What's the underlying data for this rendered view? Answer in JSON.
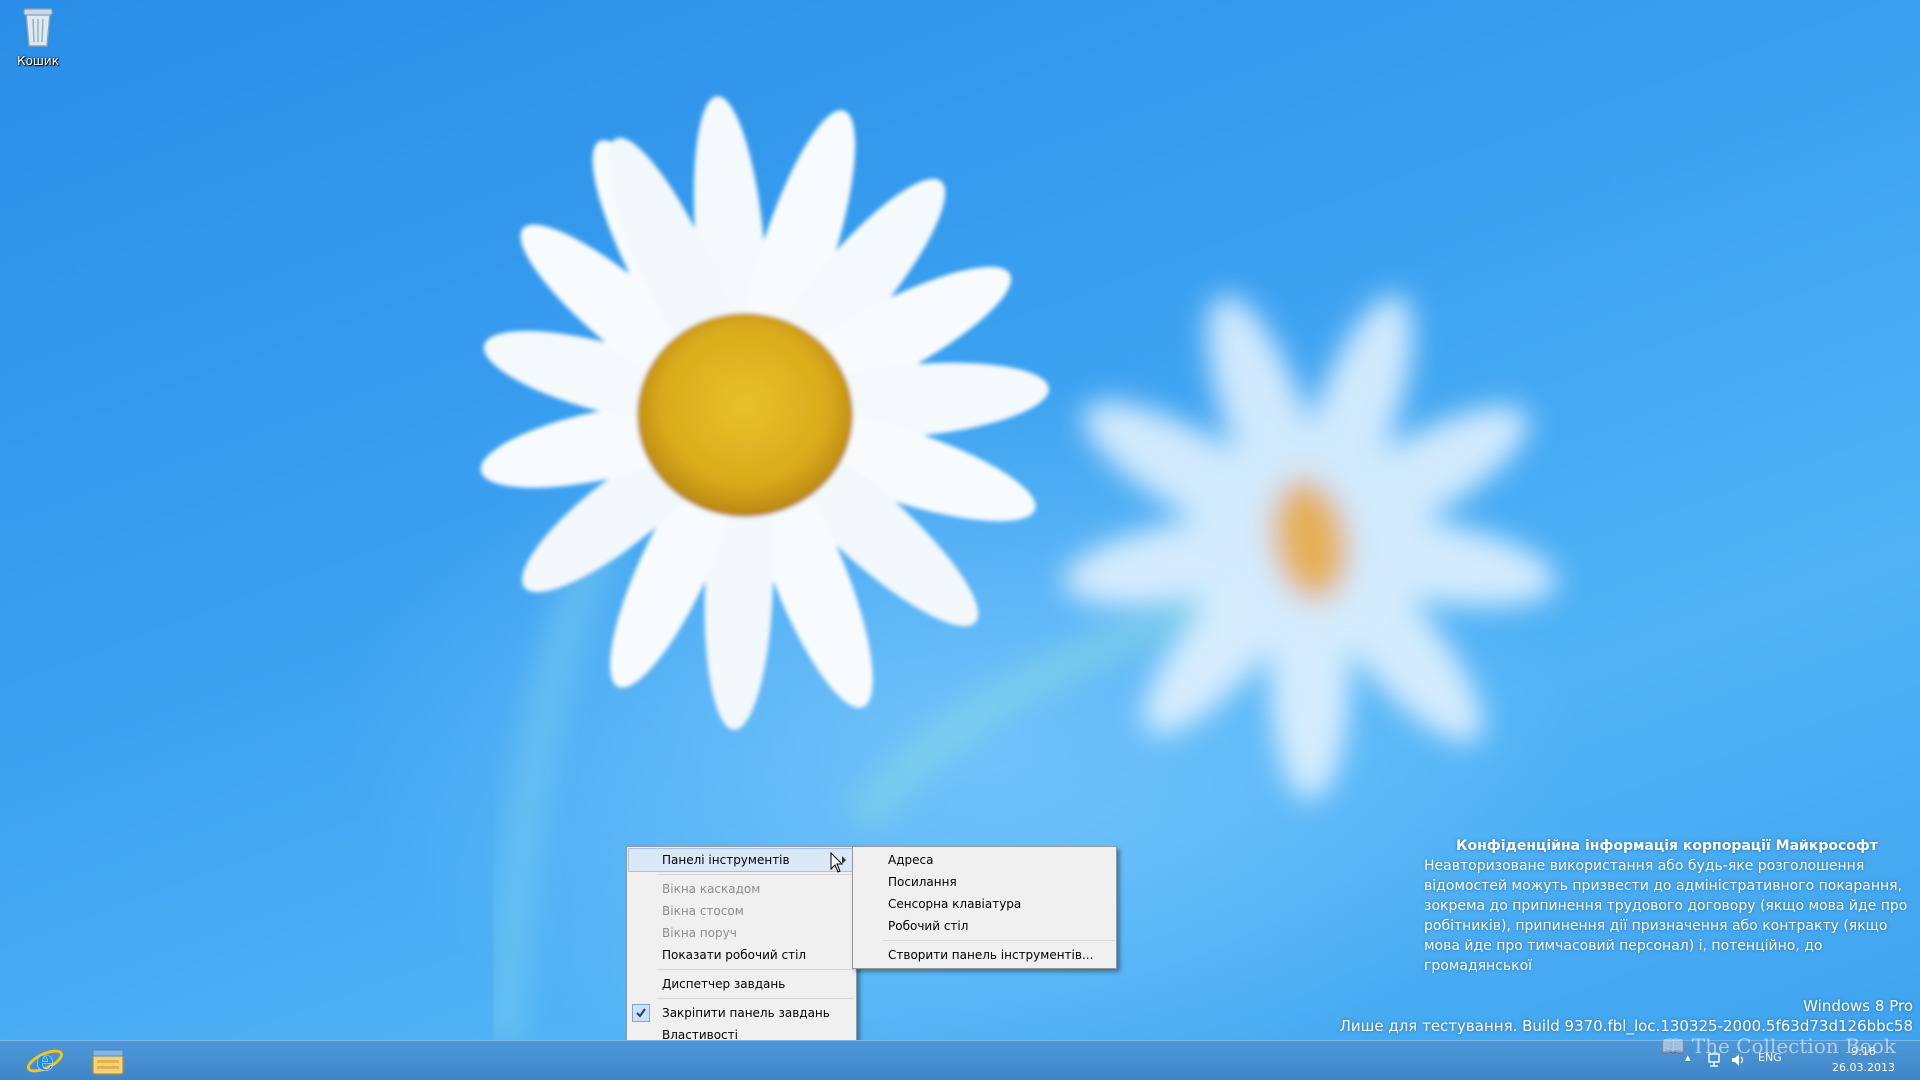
{
  "desktop": {
    "icons": [
      {
        "label": "Кошик",
        "icon": "recycle-bin-icon"
      }
    ]
  },
  "context_menu": {
    "items": [
      {
        "label": "Панелі інструментів",
        "state": "highlighted",
        "has_submenu": true
      },
      {
        "label": "Вікна каскадом",
        "state": "disabled"
      },
      {
        "label": "Вікна стосом",
        "state": "disabled"
      },
      {
        "label": "Вікна поруч",
        "state": "disabled"
      },
      {
        "label": "Показати робочий стіл",
        "state": "enabled"
      },
      {
        "label": "Диспетчер завдань",
        "state": "enabled"
      },
      {
        "label": "Закріпити панель завдань",
        "state": "checked"
      },
      {
        "label": "Властивості",
        "state": "enabled"
      }
    ]
  },
  "submenu": {
    "items": [
      {
        "label": "Адреса"
      },
      {
        "label": "Посилання"
      },
      {
        "label": "Сенсорна клавіатура"
      },
      {
        "label": "Робочий стіл"
      },
      {
        "label": "Створити панель інструментів..."
      }
    ]
  },
  "watermark": {
    "title": "Конфіденційна інформація корпорації Майкрософт",
    "body": "Неавторизоване використання або будь-яке розголошення відомостей можуть призвести до адміністративного покарання, зокрема до припинення трудового договору (якщо мова йде про робітників), припинення дії призначення або контракту (якщо мова йде про тимчасовий персонал) і, потенційно, до громадянської",
    "edition": "Windows 8 Pro",
    "build": "Лише для тестування. Build 9370.fbl_loc.130325-2000.5f63d73d126bbc58"
  },
  "taskbar": {
    "pinned": [
      {
        "name": "Internet Explorer",
        "icon": "internet-explorer-icon"
      },
      {
        "name": "File Explorer",
        "icon": "file-explorer-icon"
      }
    ],
    "tray": {
      "language": "ENG",
      "time": "9:16",
      "date": "26.03.2013"
    }
  },
  "overlay_watermark": "The Collection Book",
  "colors": {
    "sky": "#3aa0f0",
    "taskbar": "#4690d2",
    "menu_bg": "#f0f0f0",
    "menu_highlight": "#dbe8f8"
  }
}
